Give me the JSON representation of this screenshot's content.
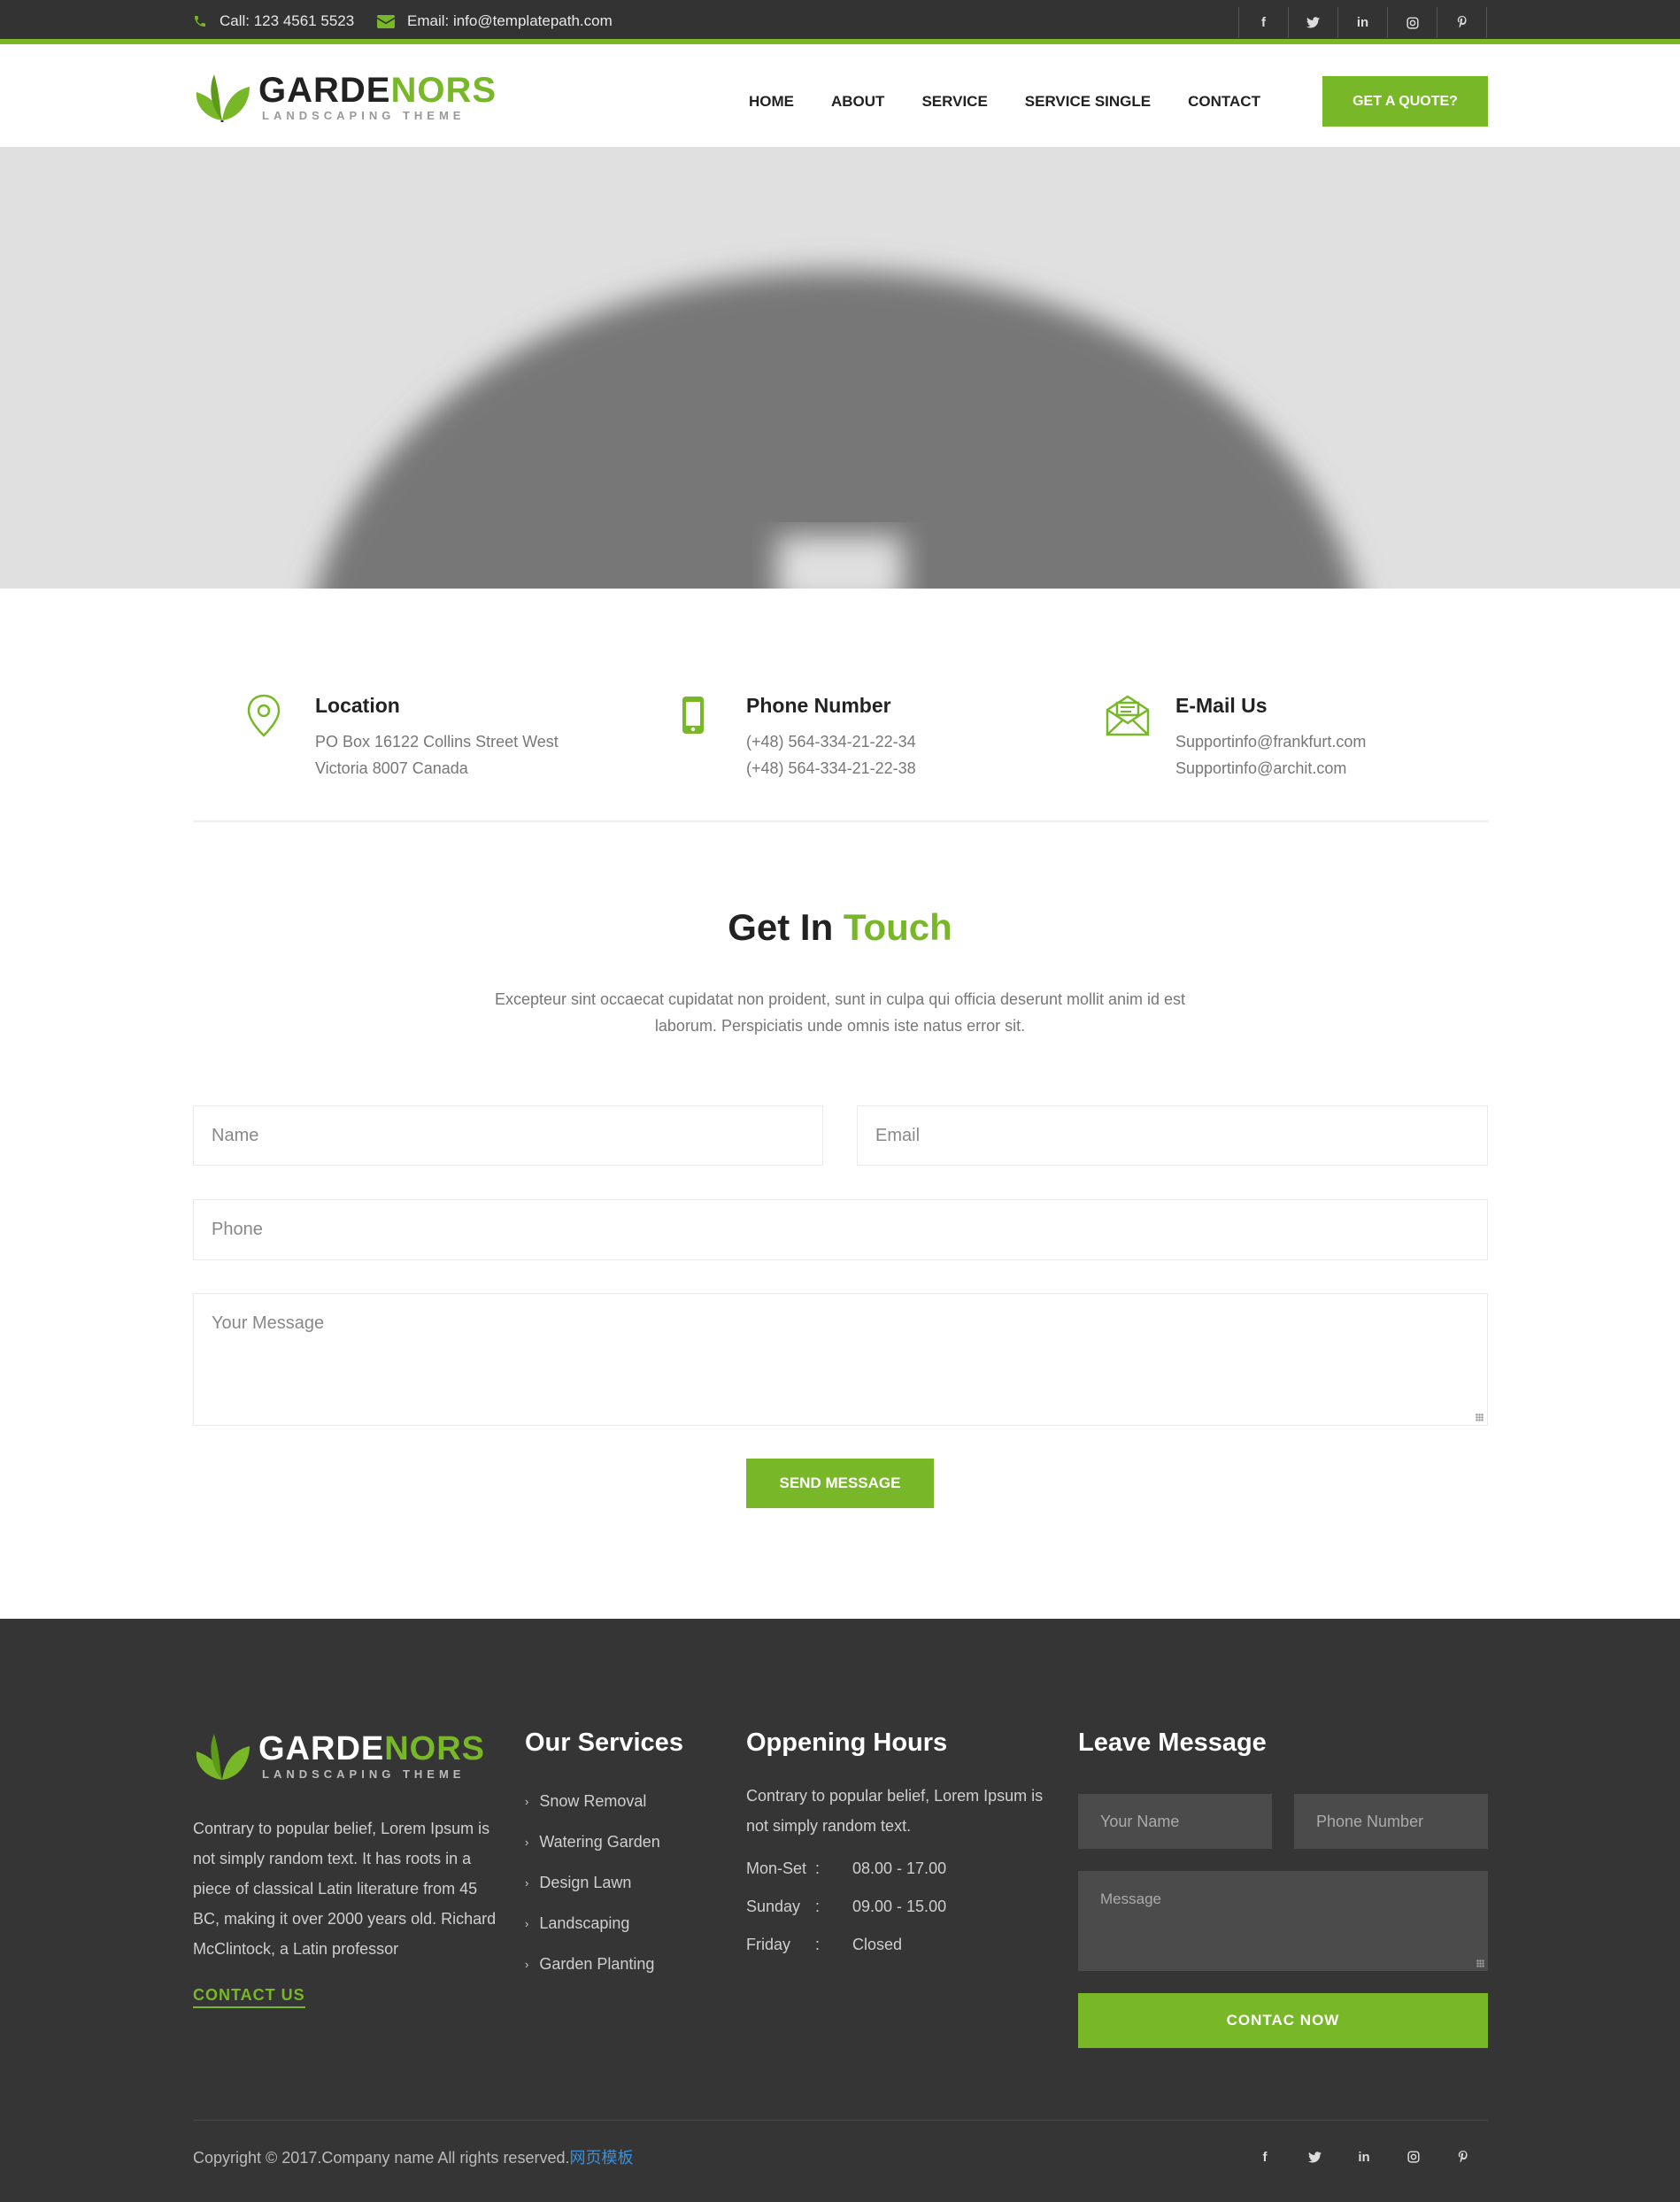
{
  "topbar": {
    "phone": "Call: 123 4561 5523",
    "email": "Email: info@templatepath.com",
    "social": [
      "f",
      "twitter",
      "in",
      "instagram",
      "pinterest"
    ]
  },
  "header": {
    "logo": {
      "brand_dark": "GARDE",
      "brand_green": "NORS",
      "tagline": "LANDSCAPING THEME"
    },
    "nav": [
      "HOME",
      "ABOUT",
      "SERVICE",
      "SERVICE SINGLE",
      "CONTACT"
    ],
    "quote_label": "GET A QUOTE?"
  },
  "contact_info": [
    {
      "icon": "map-pin-icon",
      "title": "Location",
      "lines": [
        "PO Box 16122 Collins Street West",
        "Victoria 8007 Canada"
      ]
    },
    {
      "icon": "phone-icon",
      "title": "Phone Number",
      "lines": [
        "(+48) 564-334-21-22-34",
        "(+48) 564-334-21-22-38"
      ]
    },
    {
      "icon": "envelope-icon",
      "title": "E-Mail Us",
      "lines": [
        "Supportinfo@frankfurt.com",
        "Supportinfo@archit.com"
      ]
    }
  ],
  "get_in_touch": {
    "title_dark": "Get In",
    "title_green": "Touch",
    "lead_1": "Excepteur sint occaecat cupidatat non proident, sunt in culpa qui officia deserunt mollit anim id est",
    "lead_2": "laborum. Perspiciatis unde omnis iste natus error sit.",
    "name_placeholder": "Name",
    "email_placeholder": "Email",
    "phone_placeholder": "Phone",
    "message_placeholder": "Your Message",
    "send_label": "SEND MESSAGE"
  },
  "footer": {
    "about_lines": [
      "Contrary to popular belief, Lorem Ipsum is",
      "not simply random text. It has roots in a",
      "piece of classical Latin literature from 45",
      "BC, making it over 2000 years old. Richard",
      "McClintock, a Latin professor"
    ],
    "contact_link": "CONTACT US",
    "services_title": "Our Services",
    "services": [
      "Snow Removal",
      "Watering Garden",
      "Design Lawn",
      "Landscaping",
      "Garden Planting"
    ],
    "hours_title": "Oppening Hours",
    "hours_intro_1": "Contrary to popular belief, Lorem Ipsum is",
    "hours_intro_2": "not simply random text.",
    "hours": [
      {
        "day": "Mon-Set",
        "sep": ":",
        "time": "08.00 - 17.00"
      },
      {
        "day": "Sunday",
        "sep": ":",
        "time": "09.00 - 15.00"
      },
      {
        "day": "Friday",
        "sep": ":",
        "time": "Closed"
      }
    ],
    "message_title": "Leave Message",
    "name_placeholder": "Your Name",
    "phone_placeholder": "Phone Number",
    "message_placeholder": "Message",
    "button_label": "CONTAC NOW",
    "copyright": "Copyright © 2017.Company name All rights reserved.",
    "copyright_link": "网页模板"
  },
  "colors": {
    "accent": "#78b828",
    "dark": "#333333",
    "footer": "#353535"
  }
}
